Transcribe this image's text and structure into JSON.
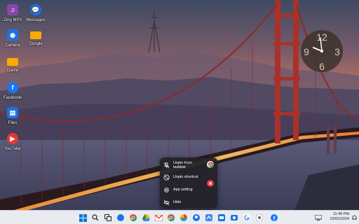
{
  "desktop_icons": [
    {
      "name": "zing-mp3",
      "label": "Zing MP3",
      "color": "#8e44ad",
      "glyph": "♫"
    },
    {
      "name": "messages",
      "label": "Messages",
      "color": "#1a73e8",
      "glyph": "💬"
    },
    {
      "name": "camera",
      "label": "Camera",
      "color": "#1a73e8",
      "glyph": "◉"
    },
    {
      "name": "google",
      "label": "Google",
      "color": "#f9ab00",
      "glyph": ""
    },
    {
      "name": "game",
      "label": "Game",
      "color": "#f9ab00",
      "glyph": ""
    },
    {
      "name": "facebook",
      "label": "Facebook",
      "color": "#1877f2",
      "glyph": "f"
    },
    {
      "name": "files",
      "label": "Files",
      "color": "#1a73e8",
      "glyph": "▤"
    },
    {
      "name": "youtube",
      "label": "YouTube",
      "color": "#e53935",
      "glyph": "▶"
    }
  ],
  "clock_widget": {
    "numbers": [
      "12",
      "3",
      "6",
      "9"
    ]
  },
  "context_menu": {
    "items": [
      {
        "label": "Unpin from taskbar",
        "icon": "unpin-icon"
      },
      {
        "label": "Unpin shortcut",
        "icon": "unpin-shortcut-icon"
      },
      {
        "label": "App setting",
        "icon": "gear-icon"
      },
      {
        "label": "Hide",
        "icon": "hide-icon"
      }
    ]
  },
  "taskbar": {
    "apps": [
      "start",
      "search",
      "task-view",
      "messages",
      "chrome",
      "drive",
      "gmail",
      "chrome-active",
      "photos",
      "maps",
      "google-maps",
      "mail",
      "camera",
      "google",
      "lens",
      "settings",
      "facebook"
    ],
    "time": "11:49 PM",
    "date": "23/02/2024"
  }
}
